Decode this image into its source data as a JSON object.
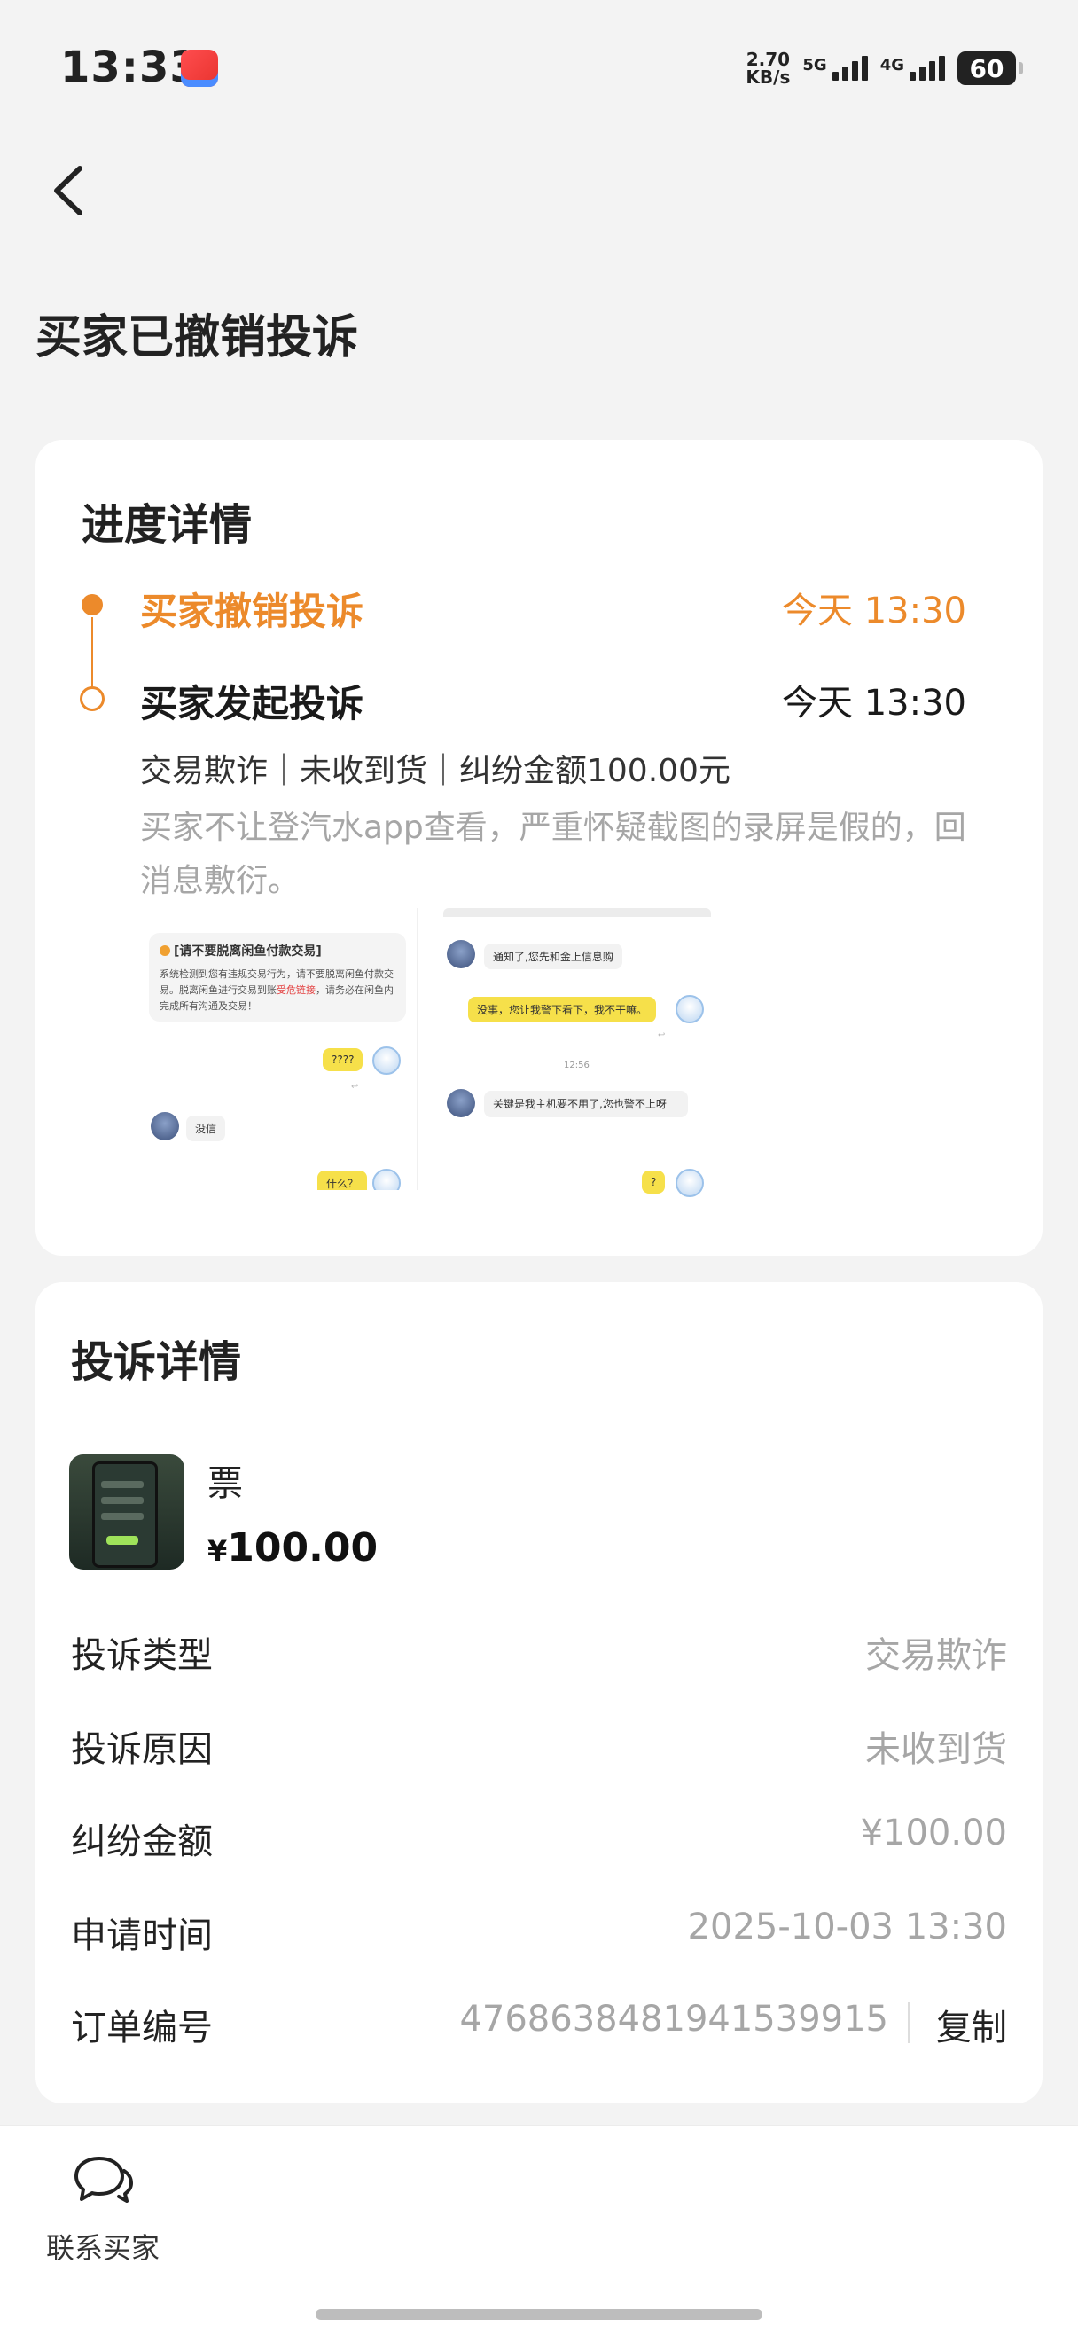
{
  "status_bar": {
    "time": "13:33",
    "speed_value": "2.70",
    "speed_unit": "KB/s",
    "net1": "5G",
    "net2": "4G",
    "battery": "60"
  },
  "page": {
    "title": "买家已撤销投诉"
  },
  "progress": {
    "title": "进度详情",
    "events": [
      {
        "title": "买家撤销投诉",
        "time": "今天 13:30",
        "active": true
      },
      {
        "title": "买家发起投诉",
        "time": "今天 13:30",
        "active": false
      }
    ],
    "detail": "交易欺诈｜未收到货｜纠纷金额100.00元",
    "description": "买家不让登汽水app查看，严重怀疑截图的录屏是假的，回消息敷衍。",
    "shot1": {
      "notice_title": "[请不要脱离闲鱼付款交易]",
      "notice_body_a": "系统检测到您有违规交易行为，请不要脱离闲鱼付款交易。脱离闲鱼进行交易到账",
      "notice_body_warn": "受危链接",
      "notice_body_b": "，请务必在闲鱼内完成所有沟通及交易！",
      "bubble_q": "????",
      "bubble_reply": "没信",
      "bubble_cut": "什么？"
    },
    "shot2": {
      "msg1": "通知了,您先和金上信息购",
      "msg2": "没事，您让我警下看下，我不干嘛。",
      "time": "12:56",
      "msg3": "关键是我主机要不用了,您也警不上呀",
      "msg4": "?"
    }
  },
  "complaint": {
    "title": "投诉详情",
    "product": {
      "name": "票",
      "price_symbol": "¥",
      "price": "100.00"
    },
    "rows": [
      {
        "label": "投诉类型",
        "value": "交易欺诈"
      },
      {
        "label": "投诉原因",
        "value": "未收到货"
      },
      {
        "label": "纠纷金额",
        "value": "¥100.00"
      },
      {
        "label": "申请时间",
        "value": "2025-10-03 13:30"
      }
    ],
    "order": {
      "label": "订单编号",
      "value": "4768638481941539915",
      "copy_label": "复制"
    }
  },
  "bottom": {
    "contact_label": "联系买家"
  },
  "colors": {
    "accent": "#ec8a2b",
    "muted": "#a6a6a6"
  }
}
